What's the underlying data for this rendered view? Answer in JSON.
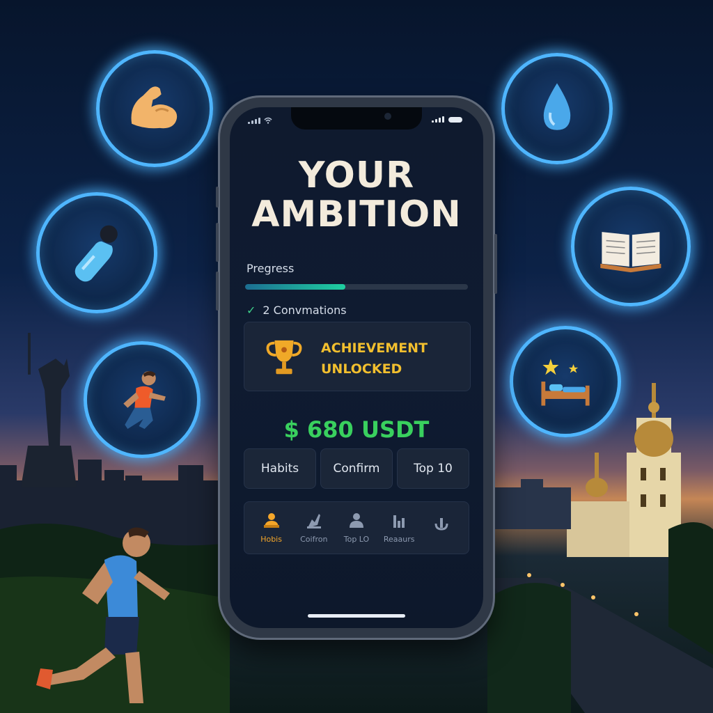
{
  "app": {
    "title_line1": "YOUR",
    "title_line2": "AMBITION"
  },
  "progress": {
    "label": "Pregress",
    "fraction": 0.45,
    "confirmations_text": "2 Convmations"
  },
  "achievement": {
    "line1": "ACHIEVEMENT",
    "line2": "UNLOCKED",
    "icon": "trophy-icon"
  },
  "balance": {
    "text": "$ 680 USDT"
  },
  "actions": [
    {
      "label": "Habits"
    },
    {
      "label": "Confirm"
    },
    {
      "label": "Top 10"
    }
  ],
  "bottom_nav": [
    {
      "label": "Hobis",
      "icon": "habits-person-icon",
      "active": true
    },
    {
      "label": "Coifron",
      "icon": "confirm-chart-icon",
      "active": false
    },
    {
      "label": "Top LO",
      "icon": "leaderboard-person-icon",
      "active": false
    },
    {
      "label": "Reaaurs",
      "icon": "rewards-bars-icon",
      "active": false
    },
    {
      "label": "",
      "icon": "settings-icon",
      "active": false
    }
  ],
  "habit_bubbles": [
    {
      "icon": "muscle-arm-icon"
    },
    {
      "icon": "water-drop-icon"
    },
    {
      "icon": "supplement-bottle-icon"
    },
    {
      "icon": "open-book-icon"
    },
    {
      "icon": "runner-icon"
    },
    {
      "icon": "bed-stars-icon"
    }
  ],
  "colors": {
    "accent_glow": "#4fb6ff",
    "achievement_gold": "#f2bf2e",
    "balance_green": "#39d05e",
    "active_nav": "#f4a62a"
  }
}
